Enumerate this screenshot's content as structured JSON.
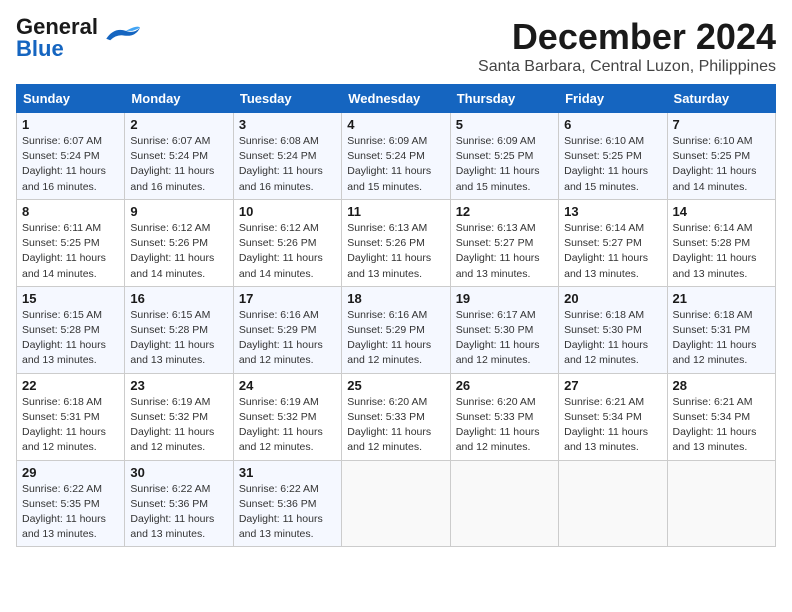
{
  "header": {
    "logo_general": "General",
    "logo_blue": "Blue",
    "month_title": "December 2024",
    "location": "Santa Barbara, Central Luzon, Philippines"
  },
  "weekdays": [
    "Sunday",
    "Monday",
    "Tuesday",
    "Wednesday",
    "Thursday",
    "Friday",
    "Saturday"
  ],
  "weeks": [
    [
      {
        "day": "1",
        "sunrise": "6:07 AM",
        "sunset": "5:24 PM",
        "daylight": "11 hours and 16 minutes."
      },
      {
        "day": "2",
        "sunrise": "6:07 AM",
        "sunset": "5:24 PM",
        "daylight": "11 hours and 16 minutes."
      },
      {
        "day": "3",
        "sunrise": "6:08 AM",
        "sunset": "5:24 PM",
        "daylight": "11 hours and 16 minutes."
      },
      {
        "day": "4",
        "sunrise": "6:09 AM",
        "sunset": "5:24 PM",
        "daylight": "11 hours and 15 minutes."
      },
      {
        "day": "5",
        "sunrise": "6:09 AM",
        "sunset": "5:25 PM",
        "daylight": "11 hours and 15 minutes."
      },
      {
        "day": "6",
        "sunrise": "6:10 AM",
        "sunset": "5:25 PM",
        "daylight": "11 hours and 15 minutes."
      },
      {
        "day": "7",
        "sunrise": "6:10 AM",
        "sunset": "5:25 PM",
        "daylight": "11 hours and 14 minutes."
      }
    ],
    [
      {
        "day": "8",
        "sunrise": "6:11 AM",
        "sunset": "5:25 PM",
        "daylight": "11 hours and 14 minutes."
      },
      {
        "day": "9",
        "sunrise": "6:12 AM",
        "sunset": "5:26 PM",
        "daylight": "11 hours and 14 minutes."
      },
      {
        "day": "10",
        "sunrise": "6:12 AM",
        "sunset": "5:26 PM",
        "daylight": "11 hours and 14 minutes."
      },
      {
        "day": "11",
        "sunrise": "6:13 AM",
        "sunset": "5:26 PM",
        "daylight": "11 hours and 13 minutes."
      },
      {
        "day": "12",
        "sunrise": "6:13 AM",
        "sunset": "5:27 PM",
        "daylight": "11 hours and 13 minutes."
      },
      {
        "day": "13",
        "sunrise": "6:14 AM",
        "sunset": "5:27 PM",
        "daylight": "11 hours and 13 minutes."
      },
      {
        "day": "14",
        "sunrise": "6:14 AM",
        "sunset": "5:28 PM",
        "daylight": "11 hours and 13 minutes."
      }
    ],
    [
      {
        "day": "15",
        "sunrise": "6:15 AM",
        "sunset": "5:28 PM",
        "daylight": "11 hours and 13 minutes."
      },
      {
        "day": "16",
        "sunrise": "6:15 AM",
        "sunset": "5:28 PM",
        "daylight": "11 hours and 13 minutes."
      },
      {
        "day": "17",
        "sunrise": "6:16 AM",
        "sunset": "5:29 PM",
        "daylight": "11 hours and 12 minutes."
      },
      {
        "day": "18",
        "sunrise": "6:16 AM",
        "sunset": "5:29 PM",
        "daylight": "11 hours and 12 minutes."
      },
      {
        "day": "19",
        "sunrise": "6:17 AM",
        "sunset": "5:30 PM",
        "daylight": "11 hours and 12 minutes."
      },
      {
        "day": "20",
        "sunrise": "6:18 AM",
        "sunset": "5:30 PM",
        "daylight": "11 hours and 12 minutes."
      },
      {
        "day": "21",
        "sunrise": "6:18 AM",
        "sunset": "5:31 PM",
        "daylight": "11 hours and 12 minutes."
      }
    ],
    [
      {
        "day": "22",
        "sunrise": "6:18 AM",
        "sunset": "5:31 PM",
        "daylight": "11 hours and 12 minutes."
      },
      {
        "day": "23",
        "sunrise": "6:19 AM",
        "sunset": "5:32 PM",
        "daylight": "11 hours and 12 minutes."
      },
      {
        "day": "24",
        "sunrise": "6:19 AM",
        "sunset": "5:32 PM",
        "daylight": "11 hours and 12 minutes."
      },
      {
        "day": "25",
        "sunrise": "6:20 AM",
        "sunset": "5:33 PM",
        "daylight": "11 hours and 12 minutes."
      },
      {
        "day": "26",
        "sunrise": "6:20 AM",
        "sunset": "5:33 PM",
        "daylight": "11 hours and 12 minutes."
      },
      {
        "day": "27",
        "sunrise": "6:21 AM",
        "sunset": "5:34 PM",
        "daylight": "11 hours and 13 minutes."
      },
      {
        "day": "28",
        "sunrise": "6:21 AM",
        "sunset": "5:34 PM",
        "daylight": "11 hours and 13 minutes."
      }
    ],
    [
      {
        "day": "29",
        "sunrise": "6:22 AM",
        "sunset": "5:35 PM",
        "daylight": "11 hours and 13 minutes."
      },
      {
        "day": "30",
        "sunrise": "6:22 AM",
        "sunset": "5:36 PM",
        "daylight": "11 hours and 13 minutes."
      },
      {
        "day": "31",
        "sunrise": "6:22 AM",
        "sunset": "5:36 PM",
        "daylight": "11 hours and 13 minutes."
      },
      null,
      null,
      null,
      null
    ]
  ]
}
